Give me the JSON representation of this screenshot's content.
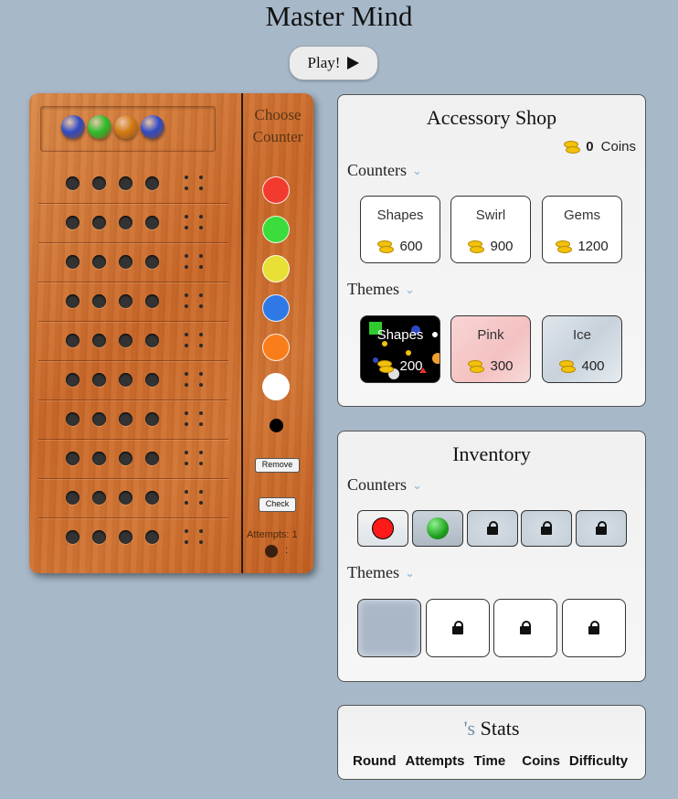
{
  "title": "Master Mind",
  "play_button": {
    "label": "Play!"
  },
  "board": {
    "secret_colors": [
      "#2f49c4",
      "#2bbd2b",
      "#d17a12",
      "#2f49c4"
    ],
    "choose_counter_label": "Choose Counter",
    "palette": [
      "#f23b2e",
      "#3bdc3b",
      "#e8e035",
      "#2f79e6",
      "#fa7d1c",
      "#ffffff"
    ],
    "remove_label": "Remove",
    "check_label": "Check",
    "attempts_label": "Attempts: 1",
    "timer_text": ":"
  },
  "shop": {
    "title": "Accessory Shop",
    "coins_value": "0",
    "coins_label": "Coins",
    "counters_label": "Counters",
    "themes_label": "Themes",
    "counters": [
      {
        "name": "Shapes",
        "price": "600"
      },
      {
        "name": "Swirl",
        "price": "900"
      },
      {
        "name": "Gems",
        "price": "1200"
      }
    ],
    "themes": [
      {
        "name": "Shapes",
        "price": "200"
      },
      {
        "name": "Pink",
        "price": "300"
      },
      {
        "name": "Ice",
        "price": "400"
      }
    ]
  },
  "inventory": {
    "title": "Inventory",
    "counters_label": "Counters",
    "themes_label": "Themes"
  },
  "stats": {
    "title_prefix": "'s",
    "title": "Stats",
    "columns": [
      "Round",
      "Attempts",
      "Time",
      "Coins",
      "Difficulty"
    ]
  },
  "icons": [
    "play-icon",
    "coin-icon",
    "chevron-down-icon",
    "lock-icon",
    "stopwatch-icon"
  ]
}
